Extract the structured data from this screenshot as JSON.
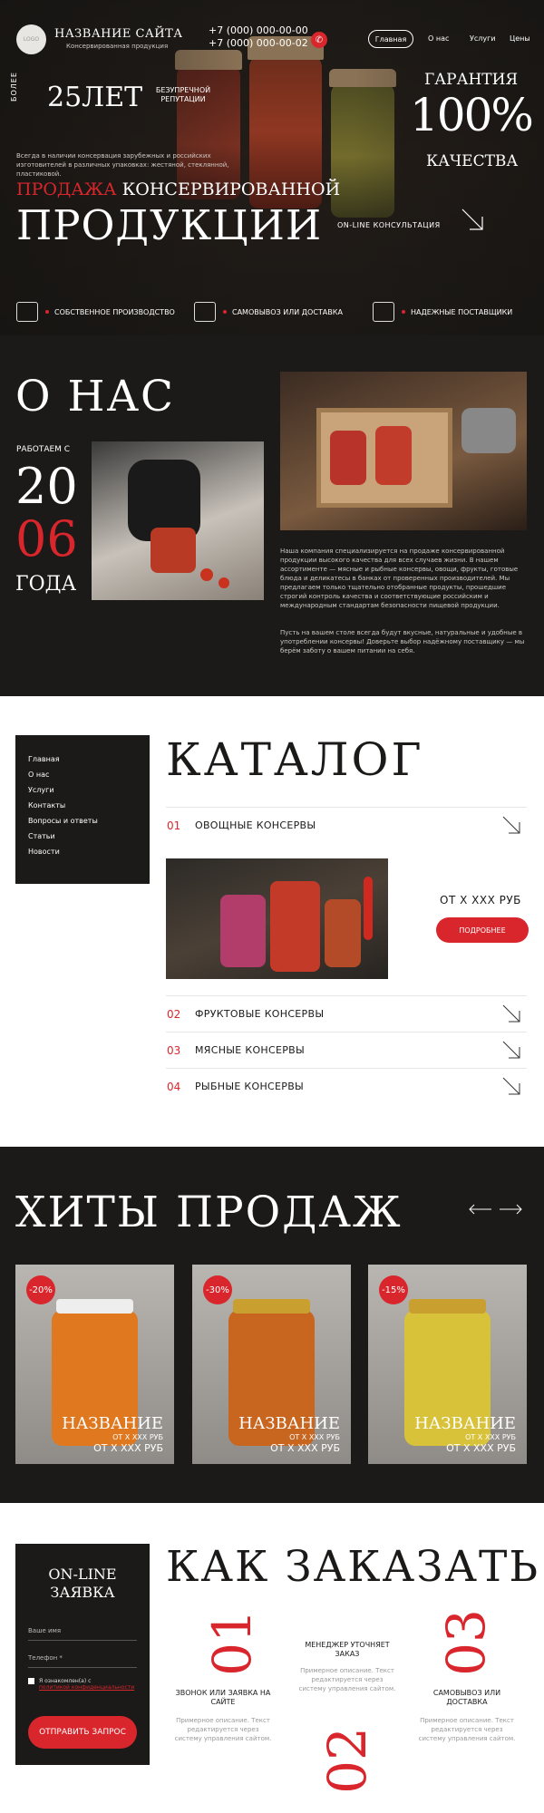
{
  "header": {
    "logo_text": "LOGO",
    "site_name": "НАЗВАНИЕ САЙТА",
    "site_sub": "Консервированная продукция",
    "phone1": "+7 (000) 000-00-00",
    "phone2": "+7 (000) 000-00-02",
    "nav": [
      "Главная",
      "О нас",
      "Услуги",
      "Цены"
    ]
  },
  "hero": {
    "more": "БОЛЕЕ",
    "years": "25ЛЕТ",
    "reputation": "БЕЗУПРЕЧНОЙ РЕПУТАЦИИ",
    "guarantee": "ГАРАНТИЯ",
    "percent": "100%",
    "quality": "КАЧЕСТВА",
    "desc": "Всегда в наличии консервация зарубежных и российских изготовителей в различных упаковках: жестяной, стеклянной, пластиковой.",
    "sell_red": "ПРОДАЖА",
    "sell_rest": "КОНСЕРВИРОВАННОЙ",
    "product": "ПРОДУКЦИИ",
    "consult": "ON-LINE КОНСУЛЬТАЦИЯ",
    "features": [
      "СОБСТВЕННОЕ ПРОИЗВОДСТВО",
      "САМОВЫВОЗ ИЛИ ДОСТАВКА",
      "НАДЕЖНЫЕ ПОСТАВЩИКИ"
    ]
  },
  "about": {
    "title": "О НАС",
    "working": "РАБОТАЕМ С",
    "year1": "20",
    "year2": "06",
    "goda": "ГОДА",
    "p1": "Наша компания специализируется на продаже консервированной продукции высокого качества для всех случаев жизни. В нашем ассортименте — мясные и рыбные консервы, овощи, фрукты, готовые блюда и деликатесы в банках от проверенных производителей. Мы предлагаем только тщательно отобранные продукты, прошедшие строгий контроль качества и соответствующие российским и международным стандартам безопасности пищевой продукции.",
    "p2": "Пусть на вашем столе всегда будут вкусные, натуральные и удобные в употреблении консервы! Доверьте выбор надёжному поставщику — мы берём заботу о вашем питании на себя."
  },
  "catalog": {
    "title": "КАТАЛОГ",
    "side": [
      "Главная",
      "О нас",
      "Услуги",
      "Контакты",
      "Вопросы и ответы",
      "Статьи",
      "Новости"
    ],
    "items": [
      {
        "num": "01",
        "name": "ОВОЩНЫЕ КОНСЕРВЫ"
      },
      {
        "num": "02",
        "name": "ФРУКТОВЫЕ КОНСЕРВЫ"
      },
      {
        "num": "03",
        "name": "МЯСНЫЕ КОНСЕРВЫ"
      },
      {
        "num": "04",
        "name": "РЫБНЫЕ КОНСЕРВЫ"
      }
    ],
    "price": "ОТ Х ХХХ РУБ",
    "more": "ПОДРОБНЕЕ"
  },
  "hits": {
    "title": "ХИТЫ ПРОДАЖ",
    "cards": [
      {
        "badge": "-20%",
        "name": "НАЗВАНИЕ",
        "old": "ОТ Х ХХХ РУБ",
        "price": "ОТ Х ХХХ РУБ",
        "color": "#e0781f"
      },
      {
        "badge": "-30%",
        "name": "НАЗВАНИЕ",
        "old": "ОТ Х ХХХ РУБ",
        "price": "ОТ Х ХХХ РУБ",
        "color": "#c8651e"
      },
      {
        "badge": "-15%",
        "name": "НАЗВАНИЕ",
        "old": "ОТ Х ХХХ РУБ",
        "price": "ОТ Х ХХХ РУБ",
        "color": "#d8c23a"
      }
    ]
  },
  "order": {
    "title": "КАК ЗАКАЗАТЬ",
    "form_title": "ON-LINE ЗАЯВКА",
    "name_ph": "Ваше имя",
    "phone_ph": "Телефон *",
    "agree": "Я ознакомлен(а) с",
    "agree_link": "политикой конфиденциальности",
    "submit": "ОТПРАВИТЬ ЗАПРОС",
    "steps": [
      {
        "num": "01",
        "title": "ЗВОНОК ИЛИ ЗАЯВКА НА САЙТЕ",
        "desc": "Примерное описание. Текст редактируется через систему управления сайтом."
      },
      {
        "num": "02",
        "title": "МЕНЕДЖЕР УТОЧНЯЕТ ЗАКАЗ",
        "desc": "Примерное описание. Текст редактируется через систему управления сайтом."
      },
      {
        "num": "03",
        "title": "САМОВЫВОЗ ИЛИ ДОСТАВКА",
        "desc": "Примерное описание. Текст редактируется через систему управления сайтом."
      }
    ]
  },
  "colors": {
    "accent": "#d9262c",
    "dark": "#1b1a19"
  }
}
